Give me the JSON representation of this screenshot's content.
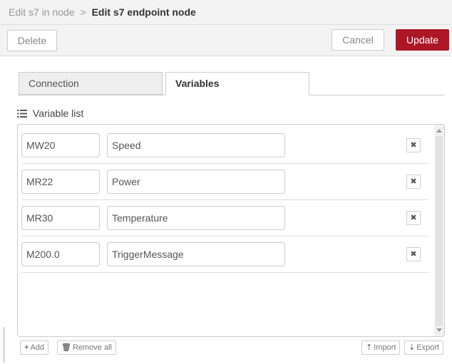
{
  "breadcrumb": {
    "previous": "Edit s7 in node",
    "separator": ">",
    "current": "Edit s7 endpoint node"
  },
  "toolbar": {
    "delete_label": "Delete",
    "cancel_label": "Cancel",
    "update_label": "Update",
    "update_color": "#ad1625"
  },
  "tabs": [
    {
      "label": "Connection",
      "active": false
    },
    {
      "label": "Variables",
      "active": true
    }
  ],
  "variables_section": {
    "label": "Variable list",
    "icon": "list-icon",
    "rows": [
      {
        "address": "MW20",
        "name": "Speed"
      },
      {
        "address": "MR22",
        "name": "Power"
      },
      {
        "address": "MR30",
        "name": "Temperature"
      },
      {
        "address": "M200.0",
        "name": "TriggerMessage"
      }
    ]
  },
  "list_buttons": {
    "add_label": "Add",
    "remove_all_label": "Remove all",
    "import_label": "Import",
    "export_label": "Export"
  }
}
